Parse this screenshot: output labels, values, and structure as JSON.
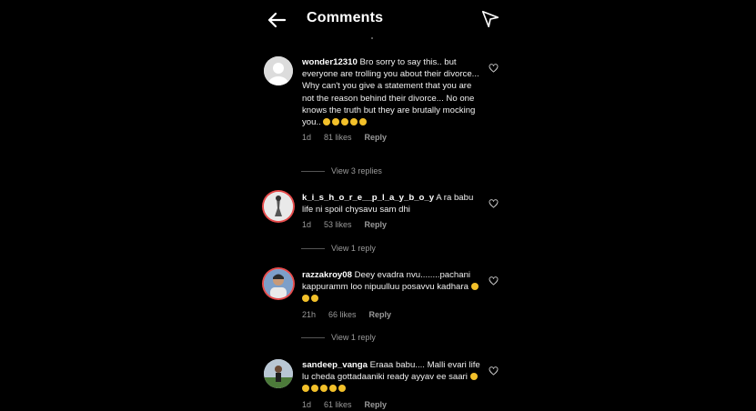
{
  "header": {
    "title": "Comments",
    "back_icon": "arrow-left-icon",
    "send_icon": "send-icon"
  },
  "comments": [
    {
      "username": "wonder12310",
      "text": "Bro sorry to say this.. but everyone are trolling you about their divorce... Why can't you give a statement that you are not the reason behind their divorce... No one knows the truth but they are brutally mocking you..",
      "emoji_count": 5,
      "time": "1d",
      "likes": "81 likes",
      "reply_label": "Reply",
      "view_replies": "View 3 replies"
    },
    {
      "username": "k_i_s_h_o_r_e__p_l_a_y_b_o_y",
      "text": "A ra babu life ni spoil chysavu sam dhi",
      "time": "1d",
      "likes": "53 likes",
      "reply_label": "Reply",
      "view_replies": "View 1 reply"
    },
    {
      "username": "razzakroy08",
      "text": "Deey evadra nvu........pachani kappuramm loo nipuulluu posavvu kadhara",
      "emoji_count": 3,
      "time": "21h",
      "likes": "66 likes",
      "reply_label": "Reply",
      "view_replies": "View 1 reply"
    },
    {
      "username": "sandeep_vanga",
      "text": "Eraaa babu.... Malli evari life lu cheda gottadaaniki ready ayyav ee saari",
      "emoji_count": 6,
      "time": "1d",
      "likes": "61 likes",
      "reply_label": "Reply"
    }
  ],
  "colors": {
    "background": "#000000",
    "text": "#ffffff",
    "muted": "#9a9a9a",
    "story_ring": "#e74c4c"
  }
}
